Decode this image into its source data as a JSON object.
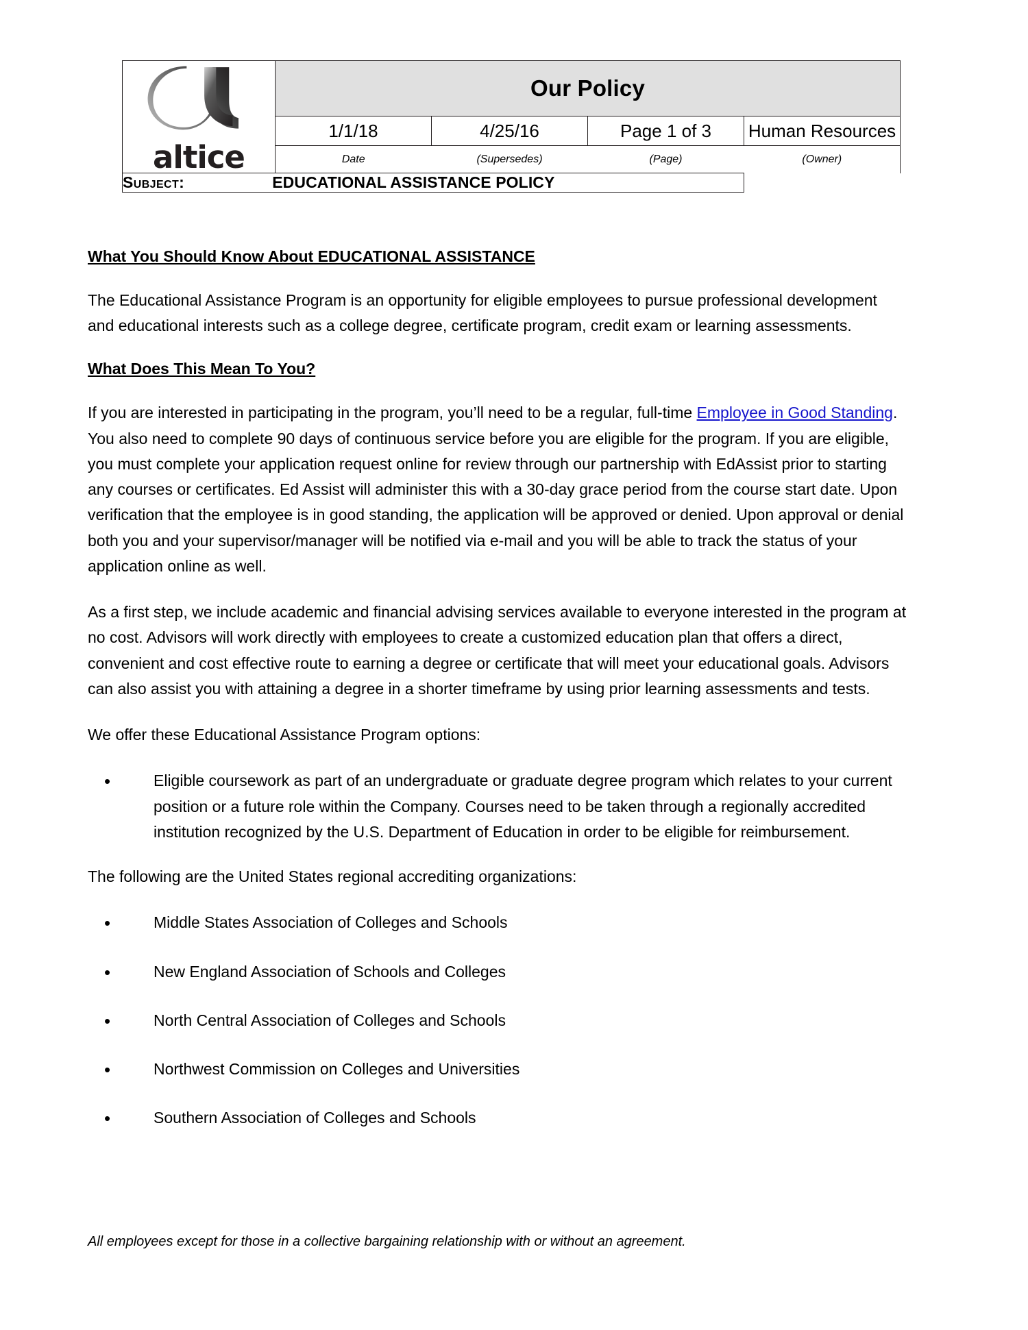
{
  "document": {
    "header": {
      "logo": {
        "name": "altice-logo",
        "wordmark": "altice"
      },
      "title": "Our Policy",
      "fields": [
        {
          "value": "1/1/18",
          "label": "Date"
        },
        {
          "value": "4/25/16",
          "label": "(Supersedes)"
        },
        {
          "value": "Page 1 of 3",
          "label": "(Page)"
        },
        {
          "value": "Human Resources",
          "label": "(Owner)"
        }
      ],
      "subject_label": "Subject:",
      "subject_value": "EDUCATIONAL ASSISTANCE POLICY"
    },
    "body": {
      "heading_1": "What You Should Know About EDUCATIONAL ASSISTANCE",
      "paragraph_1": "The Educational Assistance Program is an opportunity for eligible employees to pursue professional development and educational interests such as a college degree, certificate program, credit exam or learning assessments.",
      "heading_2": "What Does This Mean To You?",
      "paragraph_2_part_1": "If you are interested in participating in the program, you’ll need to be a regular, full-time ",
      "paragraph_2_link": "Employee in Good Standing",
      "paragraph_2_part_2": ". You also need to complete 90 days of continuous service before you are eligible for the program. If you are eligible, you must complete your application request online for review through our partnership with EdAssist prior to starting any courses or certificates. Ed Assist will administer this with a 30-day grace period from the course start date. Upon verification that the employee is in good standing, the application will be approved or denied. Upon approval or denial both you and your supervisor/manager will be notified via e-mail and you will be able to track the status of your application online as well.",
      "paragraph_3": "As a first step, we include academic and financial advising services available to everyone interested in the program at no cost.  Advisors will work directly with employees to create a customized education plan that offers a direct, convenient and cost effective route to earning a degree or certificate that will meet your educational goals.  Advisors can also assist you with attaining a degree in a shorter timeframe by using prior learning assessments and tests.",
      "paragraph_4": "We offer these Educational Assistance Program options:",
      "options_bullets": [
        "Eligible coursework as part of an undergraduate or graduate degree program which relates to your current position or a future role within the Company.  Courses need to be taken through a regionally accredited institution recognized by the U.S. Department of Education in order to be eligible for reimbursement."
      ],
      "paragraph_5": "The following are the United States regional accrediting organizations:",
      "accreditor_bullets": [
        "Middle States Association of Colleges and Schools",
        "New England Association of Schools and Colleges",
        "North Central Association of Colleges and Schools",
        "Northwest Commission on Colleges and Universities",
        "Southern Association of Colleges and Schools"
      ]
    },
    "footnote": "All employees except for those in a collective bargaining relationship with or without an agreement.",
    "colors": {
      "title_band": "#e0e0e0",
      "border": "#231f20",
      "link": "#1414cc",
      "text": "#000000"
    }
  }
}
